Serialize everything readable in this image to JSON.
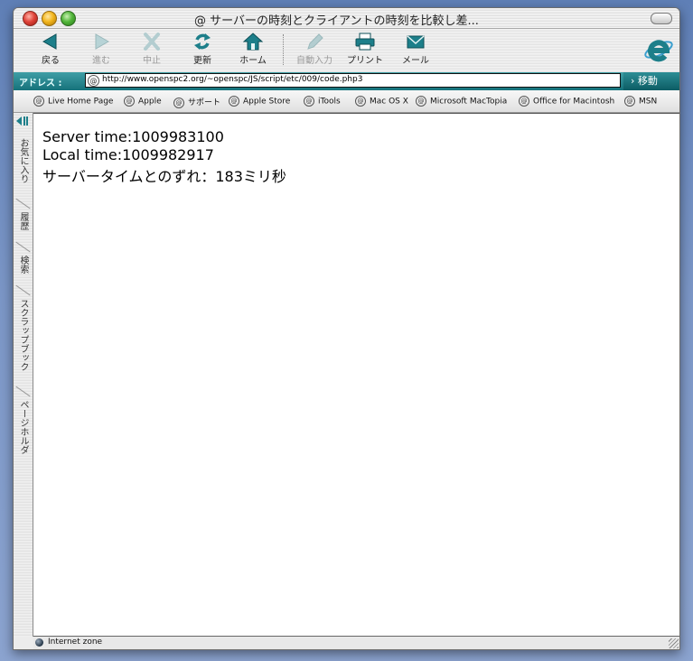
{
  "window": {
    "title": "@ サーバーの時刻とクライアントの時刻を比較し差..."
  },
  "toolbar": {
    "back": "戻る",
    "forward": "進む",
    "stop": "中止",
    "refresh": "更新",
    "home": "ホーム",
    "autofill": "自動入力",
    "print": "プリント",
    "mail": "メール"
  },
  "address": {
    "label": "アドレス :",
    "url": "http://www.openspc2.org/~openspc/JS/script/etc/009/code.php3",
    "go": "移動"
  },
  "favorites": [
    "Live Home Page",
    "Apple",
    "サポート",
    "Apple Store",
    "iTools",
    "Mac OS X",
    "Microsoft MacTopia",
    "Office for Macintosh",
    "MSN"
  ],
  "sidetabs": [
    "お気に入り",
    "履歴",
    "検索",
    "スクラップブック",
    "ページホルダ"
  ],
  "content": {
    "server_time": "Server time:1009983100",
    "local_time": "Local time:1009982917",
    "difference": "サーバータイムとのずれ：183ミリ秒"
  },
  "status": {
    "zone": "Internet zone"
  },
  "colors": {
    "addressbar": "#1e7c85",
    "desktop": "#6f8cc0"
  }
}
